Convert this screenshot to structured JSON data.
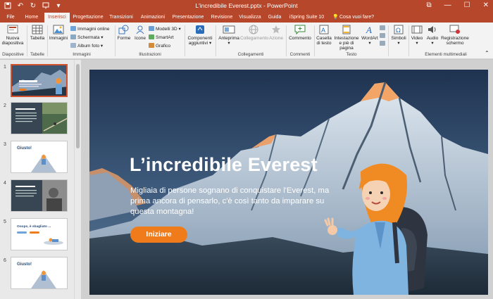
{
  "window": {
    "title": "L'incredibile Everest.pptx  -  PowerPoint",
    "controls": {
      "restore": "⧉",
      "minimize": "—",
      "maximize": "☐",
      "close": "✕"
    }
  },
  "quick_access": {
    "save_icon": "save-icon",
    "undo_icon": "undo-icon",
    "redo_icon": "redo-icon",
    "present_icon": "present-icon",
    "more_icon": "customize-icon"
  },
  "tabs": [
    "File",
    "Home",
    "Inserisci",
    "Progettazione",
    "Transizioni",
    "Animazioni",
    "Presentazione",
    "Revisione",
    "Visualizza",
    "Guida",
    "iSpring Suite 10",
    "Cosa vuoi fare?"
  ],
  "active_tab": "Inserisci",
  "ribbon": {
    "diapositive": {
      "new_slide": "Nuova diapositiva",
      "group": "Diapositive"
    },
    "tabelle": {
      "table": "Tabella",
      "group": "Tabelle"
    },
    "immagini": {
      "images": "Immagini",
      "online": "Immagini online",
      "screenshot": "Schermata",
      "album": "Album foto",
      "group": "Immagini"
    },
    "illustrazioni": {
      "shapes": "Forme",
      "icons": "Icone",
      "models3d": "Modelli 3D",
      "smartart": "SmartArt",
      "chart": "Grafico",
      "group": "Illustrazioni"
    },
    "componenti": {
      "addins": "Componenti aggiuntivi"
    },
    "collegamenti": {
      "preview": "Anteprima",
      "link": "Collegamento",
      "action": "Azione",
      "group": "Collegamenti"
    },
    "commenti": {
      "comment": "Commento",
      "group": "Commenti"
    },
    "testo": {
      "textbox": "Casella di testo",
      "header": "Intestazione e piè di pagina",
      "wordart": "WordArt",
      "group": "Testo"
    },
    "simboli": {
      "symbols": "Simboli"
    },
    "multimedia": {
      "video": "Video",
      "audio": "Audio",
      "record": "Registrazione schermo",
      "group": "Elementi multimediali"
    }
  },
  "thumbnails": [
    {
      "number": "1",
      "title": "L'incredibile Everest",
      "selected": true
    },
    {
      "number": "2",
      "title": "",
      "selected": false
    },
    {
      "number": "3",
      "title": "Giusto!",
      "selected": false
    },
    {
      "number": "4",
      "title": "",
      "selected": false
    },
    {
      "number": "5",
      "title": "Ooops, è sbagliato ...",
      "selected": false
    },
    {
      "number": "6",
      "title": "Giusto!",
      "selected": false
    }
  ],
  "slide": {
    "title": "L’incredibile Everest",
    "subtitle": "Migliaia di persone sognano di conquistare l'Everest, ma prima ancora di pensarlo, c'è così tanto da imparare su questa montagna!",
    "button": "Iniziare"
  },
  "colors": {
    "accent": "#b7472a",
    "button": "#f07b1b",
    "selection": "#d35230"
  }
}
